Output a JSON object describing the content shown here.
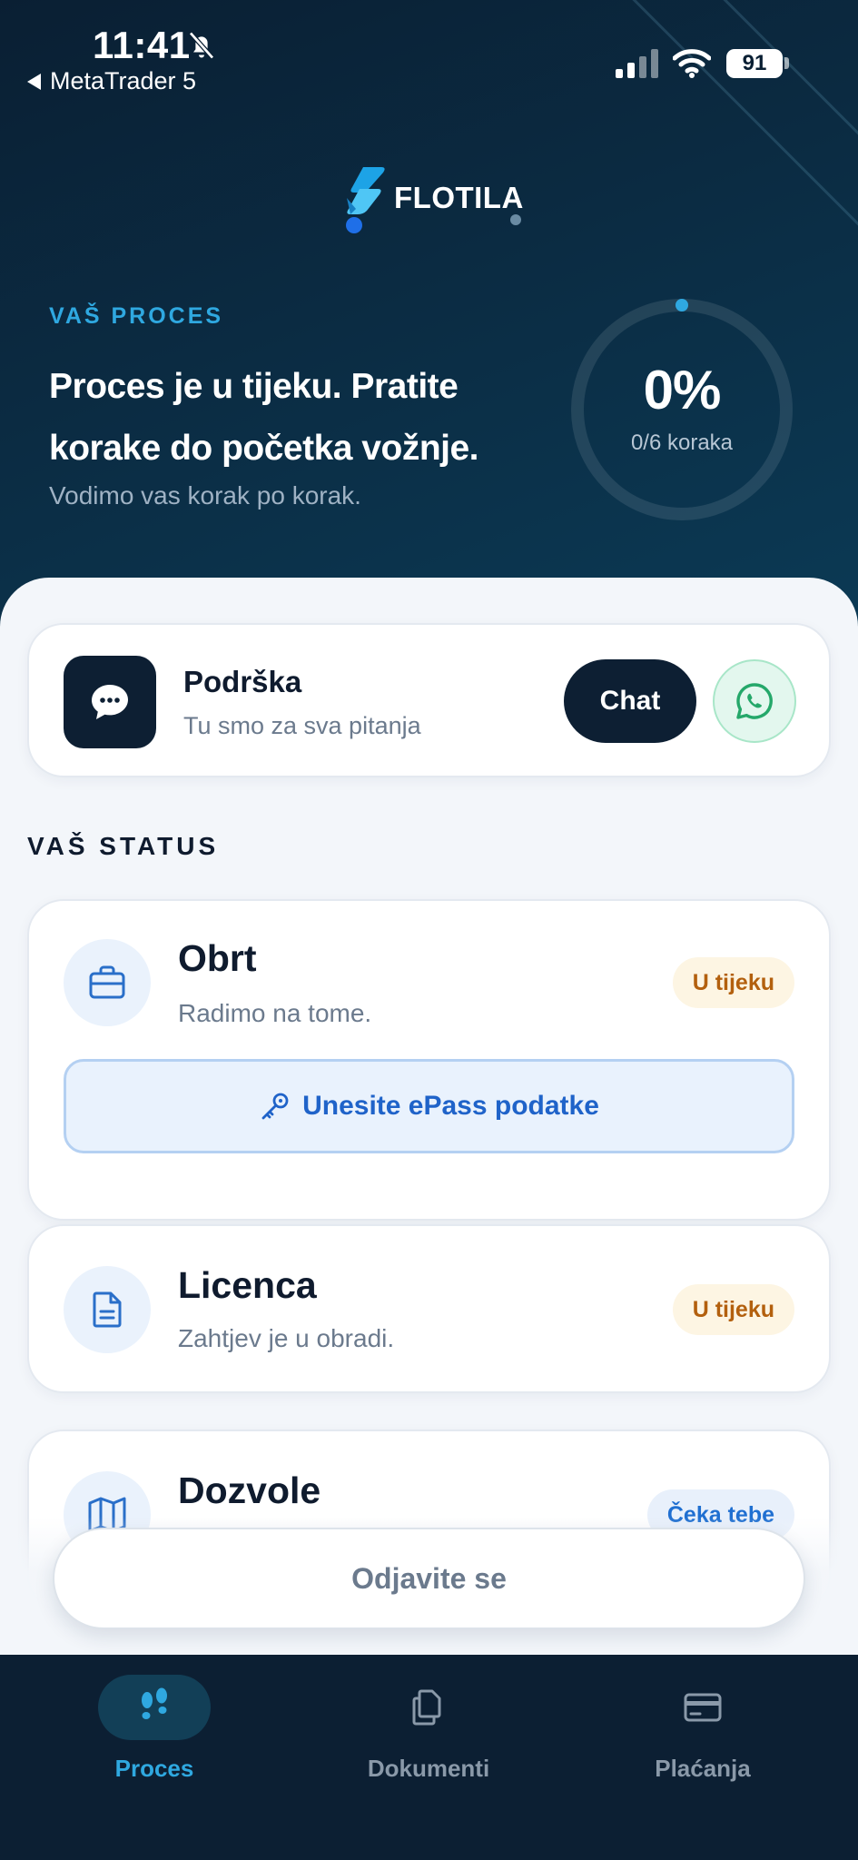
{
  "status_bar": {
    "time": "11:41",
    "back_app": "MetaTrader 5",
    "battery": "91"
  },
  "brand": {
    "name": "FLOTILA"
  },
  "hero": {
    "label": "VAŠ PROCES",
    "title": "Proces je u tijeku. Pratite korake do početka vožnje.",
    "subtitle": "Vodimo vas korak po korak.",
    "progress_percent": "0%",
    "progress_steps": "0/6 koraka",
    "progress_fraction": 0
  },
  "support": {
    "title": "Podrška",
    "subtitle": "Tu smo za sva pitanja",
    "chat_label": "Chat"
  },
  "status_section": {
    "heading": "VAŠ STATUS",
    "items": [
      {
        "title": "Obrt",
        "subtitle": "Radimo na tome.",
        "badge": "U tijeku",
        "icon": "briefcase-icon",
        "action": "Unesite ePass podatke"
      },
      {
        "title": "Licenca",
        "subtitle": "Zahtjev je u obradi.",
        "badge": "U tijeku",
        "icon": "document-icon"
      },
      {
        "title": "Dozvole",
        "badge": "Čeka tebe",
        "icon": "map-icon"
      }
    ]
  },
  "logout_label": "Odjavite se",
  "tabs": [
    {
      "label": "Proces",
      "icon": "footsteps-icon",
      "active": true
    },
    {
      "label": "Dokumenti",
      "icon": "documents-icon",
      "active": false
    },
    {
      "label": "Plaćanja",
      "icon": "credit-card-icon",
      "active": false
    }
  ],
  "colors": {
    "hero_bg": "#0b2b42",
    "accent": "#2fa8e0",
    "dark": "#0d1f33",
    "badge_progress": "#b3600e",
    "badge_wait": "#1f6fd1",
    "whatsapp": "#25a86a"
  }
}
